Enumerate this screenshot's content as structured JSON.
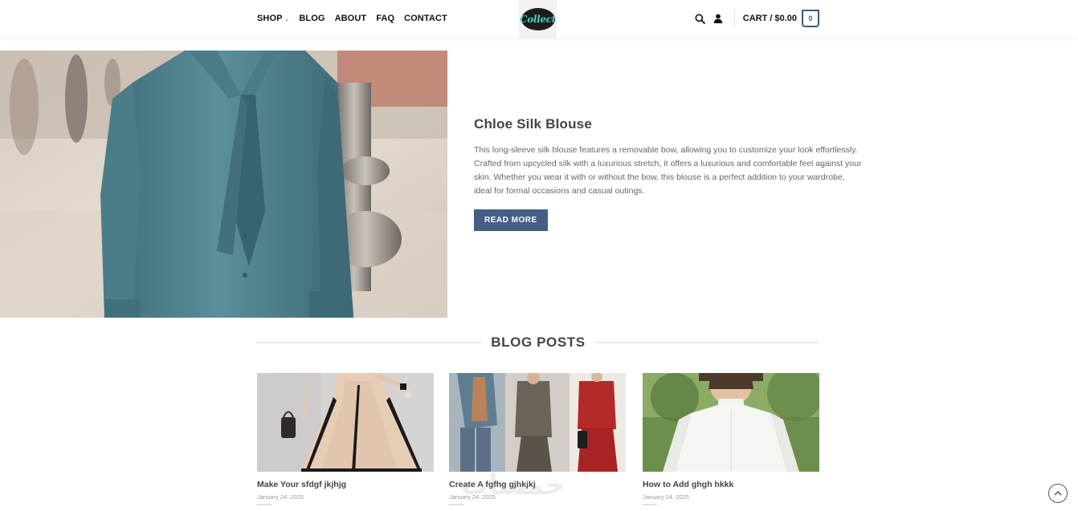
{
  "header": {
    "nav": [
      {
        "label": "SHOP",
        "has_dropdown": true
      },
      {
        "label": "BLOG"
      },
      {
        "label": "ABOUT"
      },
      {
        "label": "FAQ"
      },
      {
        "label": "CONTACT"
      }
    ],
    "logo_text": "Collect",
    "cart_label": "CART / $0.00",
    "cart_count": "0",
    "icons": [
      "search-icon",
      "user-icon",
      "cart-bag-icon"
    ]
  },
  "hero": {
    "title": "Chloe Silk Blouse",
    "description": "This long-sleeve silk blouse features a removable bow, allowing you to customize your look effortlessly. Crafted from upcycled silk with a luxurious stretch, it offers a luxurious and comfortable feel against your skin. Whether you wear it with or without the bow, this blouse is a perfect addition to your wardrobe, ideal for formal occasions and casual outings.",
    "button_label": "READ MORE"
  },
  "blog": {
    "section_title": "BLOG POSTS",
    "posts": [
      {
        "title": "Make Your sfdgf jkjhjg",
        "date": "January 24, 2025"
      },
      {
        "title": "Create A fgfhg gjhkjkj",
        "date": "January 24, 2025"
      },
      {
        "title": "How to Add ghgh hkkk",
        "date": "January 24, 2025"
      }
    ]
  },
  "watermark": "خمسات",
  "colors": {
    "accent": "#445e86",
    "text_dark": "#444444",
    "text_body": "#666666",
    "logo_teal": "#43d1c8"
  }
}
